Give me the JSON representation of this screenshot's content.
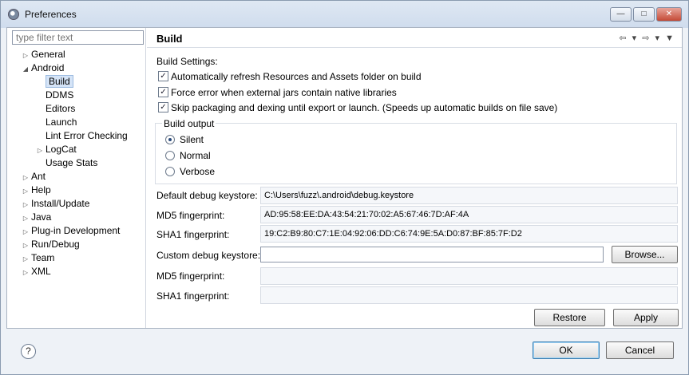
{
  "window": {
    "title": "Preferences",
    "minimize_icon": "minimize-icon",
    "maximize_icon": "maximize-icon",
    "close_icon": "close-icon"
  },
  "sidebar": {
    "filter_placeholder": "type filter text",
    "items": [
      {
        "label": "General",
        "level": 0,
        "expander": "collapsed"
      },
      {
        "label": "Android",
        "level": 0,
        "expander": "expanded"
      },
      {
        "label": "Build",
        "level": 1,
        "selected": true
      },
      {
        "label": "DDMS",
        "level": 1
      },
      {
        "label": "Editors",
        "level": 1
      },
      {
        "label": "Launch",
        "level": 1
      },
      {
        "label": "Lint Error Checking",
        "level": 1
      },
      {
        "label": "LogCat",
        "level": 1,
        "expander": "collapsed"
      },
      {
        "label": "Usage Stats",
        "level": 1
      },
      {
        "label": "Ant",
        "level": 0,
        "expander": "collapsed"
      },
      {
        "label": "Help",
        "level": 0,
        "expander": "collapsed"
      },
      {
        "label": "Install/Update",
        "level": 0,
        "expander": "collapsed"
      },
      {
        "label": "Java",
        "level": 0,
        "expander": "collapsed"
      },
      {
        "label": "Plug-in Development",
        "level": 0,
        "expander": "collapsed"
      },
      {
        "label": "Run/Debug",
        "level": 0,
        "expander": "collapsed"
      },
      {
        "label": "Team",
        "level": 0,
        "expander": "collapsed"
      },
      {
        "label": "XML",
        "level": 0,
        "expander": "collapsed"
      }
    ]
  },
  "page": {
    "title": "Build",
    "nav_icons": "⇦ ▾ ⇨ ▾ ▼"
  },
  "build_settings": {
    "heading": "Build Settings:",
    "options": [
      {
        "label": "Automatically refresh Resources and Assets folder on build",
        "checked": true
      },
      {
        "label": "Force error when external jars contain native libraries",
        "checked": true
      },
      {
        "label": "Skip packaging and dexing until export or launch. (Speeds up automatic builds on file save)",
        "checked": true
      }
    ]
  },
  "build_output": {
    "title": "Build output",
    "options": [
      {
        "label": "Silent",
        "selected": true
      },
      {
        "label": "Normal",
        "selected": false
      },
      {
        "label": "Verbose",
        "selected": false
      }
    ]
  },
  "keystore": {
    "default_label": "Default debug keystore:",
    "default_value": "C:\\Users\\fuzz\\.android\\debug.keystore",
    "md5_label": "MD5 fingerprint:",
    "md5_value": "AD:95:58:EE:DA:43:54:21:70:02:A5:67:46:7D:AF:4A",
    "sha1_label": "SHA1 fingerprint:",
    "sha1_value": "19:C2:B9:80:C7:1E:04:92:06:DD:C6:74:9E:5A:D0:87:BF:85:7F:D2",
    "custom_label": "Custom debug keystore:",
    "custom_value": "",
    "browse_label": "Browse...",
    "custom_md5_label": "MD5 fingerprint:",
    "custom_md5_value": "",
    "custom_sha1_label": "SHA1 fingerprint:",
    "custom_sha1_value": ""
  },
  "buttons": {
    "restore_defaults": "Restore Defaults",
    "apply": "Apply",
    "ok": "OK",
    "cancel": "Cancel",
    "help_icon": "help-icon"
  }
}
